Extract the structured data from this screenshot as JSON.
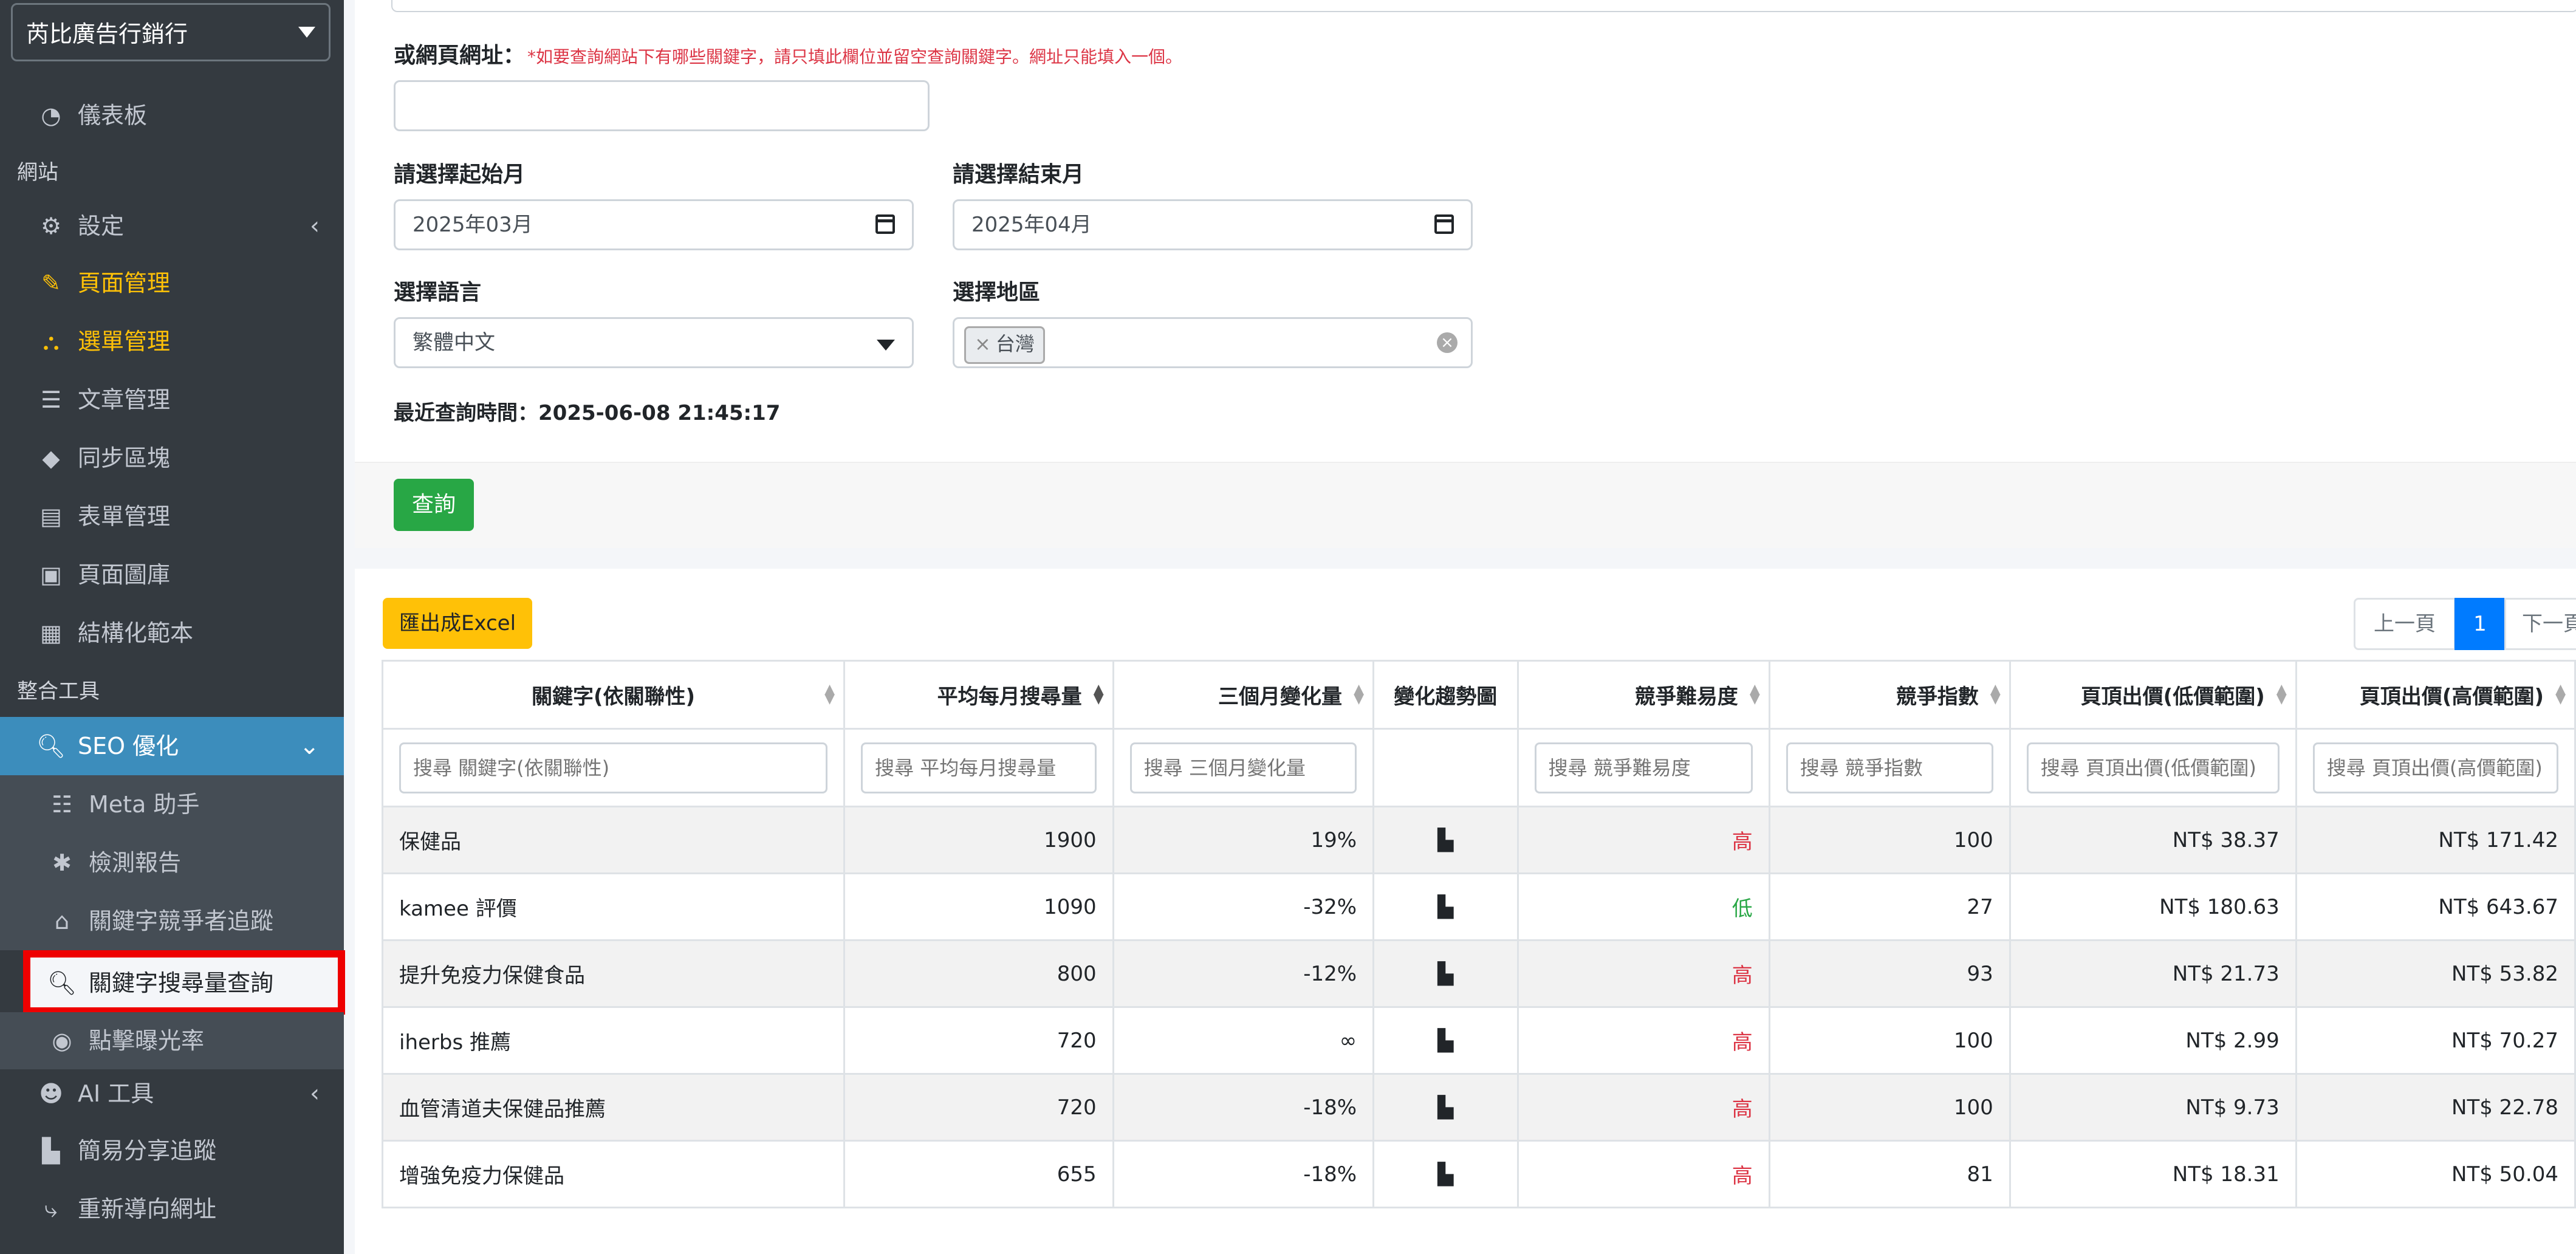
{
  "sidebar": {
    "site_name": "芮比廣告行銷行",
    "dashboard": "儀表板",
    "section_site": "網站",
    "settings": "設定",
    "page_mgmt": "頁面管理",
    "menu_mgmt": "選單管理",
    "article_mgmt": "文章管理",
    "sync_blocks": "同步區塊",
    "form_mgmt": "表單管理",
    "gallery": "頁面圖庫",
    "structured": "結構化範本",
    "section_tools": "整合工具",
    "seo": "SEO 優化",
    "meta": "Meta 助手",
    "report": "檢測報告",
    "competitor": "關鍵字競爭者追蹤",
    "volume": "關鍵字搜尋量查詢",
    "ctr": "點擊曝光率",
    "ai": "AI 工具",
    "share": "簡易分享追蹤",
    "redirect": "重新導向網址"
  },
  "form": {
    "url_label": "或網頁網址：",
    "url_hint": "*如要查詢網站下有哪些關鍵字，請只填此欄位並留空查詢關鍵字。網址只能填入一個。",
    "url_value": "",
    "start_label": "請選擇起始月",
    "start_value": "2025年03月",
    "end_label": "請選擇結束月",
    "end_value": "2025年04月",
    "lang_label": "選擇語言",
    "lang_value": "繁體中文",
    "region_label": "選擇地區",
    "region_tag": "台灣",
    "last_query": "最近查詢時間：2025-06-08 21:45:17",
    "query_btn": "查詢"
  },
  "results": {
    "export_btn": "匯出成Excel",
    "prev": "上一頁",
    "page": "1",
    "next": "下一頁",
    "headers": [
      "關鍵字(依關聯性)",
      "平均每月搜尋量",
      "三個月變化量",
      "變化趨勢圖",
      "競爭難易度",
      "競爭指數",
      "頁頂出價(低價範圍)",
      "頁頂出價(高價範圍)"
    ],
    "placeholders": [
      "搜尋 關鍵字(依關聯性)",
      "搜尋 平均每月搜尋量",
      "搜尋 三個月變化量",
      "搜尋 競爭難易度",
      "搜尋 競爭指數",
      "搜尋 頁頂出價(低價範圍)",
      "搜尋 頁頂出價(高價範圍)"
    ],
    "rows": [
      {
        "kw": "保健品",
        "vol": "1900",
        "chg": "19%",
        "diff": "高",
        "idx": "100",
        "low": "NT$ 38.37",
        "high": "NT$ 171.42"
      },
      {
        "kw": "kamee 評價",
        "vol": "1090",
        "chg": "-32%",
        "diff": "低",
        "idx": "27",
        "low": "NT$ 180.63",
        "high": "NT$ 643.67"
      },
      {
        "kw": "提升免疫力保健食品",
        "vol": "800",
        "chg": "-12%",
        "diff": "高",
        "idx": "93",
        "low": "NT$ 21.73",
        "high": "NT$ 53.82"
      },
      {
        "kw": "iherbs 推薦",
        "vol": "720",
        "chg": "∞",
        "diff": "高",
        "idx": "100",
        "low": "NT$ 2.99",
        "high": "NT$ 70.27"
      },
      {
        "kw": "血管清道夫保健品推薦",
        "vol": "720",
        "chg": "-18%",
        "diff": "高",
        "idx": "100",
        "low": "NT$ 9.73",
        "high": "NT$ 22.78"
      },
      {
        "kw": "增強免疫力保健品",
        "vol": "655",
        "chg": "-18%",
        "diff": "高",
        "idx": "81",
        "low": "NT$ 18.31",
        "high": "NT$ 50.04"
      }
    ]
  }
}
